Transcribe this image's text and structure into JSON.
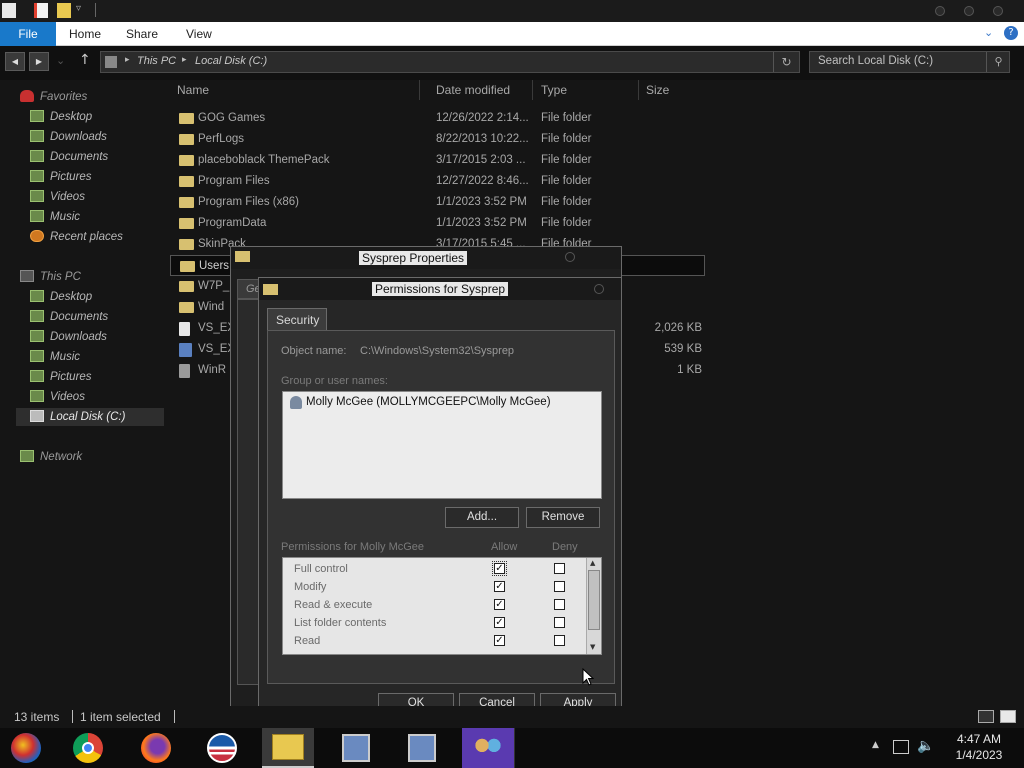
{
  "ribbon": {
    "file": "File",
    "home": "Home",
    "share": "Share",
    "view": "View"
  },
  "address": {
    "crumb1": "This PC",
    "crumb2": "Local Disk (C:)",
    "search_placeholder": "Search Local Disk (C:)"
  },
  "nav": {
    "favorites": "Favorites",
    "fav_items": [
      "Desktop",
      "Downloads",
      "Documents",
      "Pictures",
      "Videos",
      "Music",
      "Recent places"
    ],
    "this_pc": "This PC",
    "pc_items": [
      "Desktop",
      "Documents",
      "Downloads",
      "Music",
      "Pictures",
      "Videos",
      "Local Disk (C:)"
    ],
    "network": "Network"
  },
  "columns": {
    "name": "Name",
    "date": "Date modified",
    "type": "Type",
    "size": "Size"
  },
  "files": [
    {
      "name": "GOG Games",
      "date": "12/26/2022 2:14...",
      "type": "File folder",
      "size": ""
    },
    {
      "name": "PerfLogs",
      "date": "8/22/2013 10:22...",
      "type": "File folder",
      "size": ""
    },
    {
      "name": "placeboblack ThemePack",
      "date": "3/17/2015 2:03 ...",
      "type": "File folder",
      "size": ""
    },
    {
      "name": "Program Files",
      "date": "12/27/2022 8:46...",
      "type": "File folder",
      "size": ""
    },
    {
      "name": "Program Files (x86)",
      "date": "1/1/2023 3:52 PM",
      "type": "File folder",
      "size": ""
    },
    {
      "name": "ProgramData",
      "date": "1/1/2023 3:52 PM",
      "type": "File folder",
      "size": ""
    },
    {
      "name": "SkinPack",
      "date": "3/17/2015 5:45 ...",
      "type": "File folder",
      "size": ""
    },
    {
      "name": "Users",
      "date": "",
      "type": "",
      "size": ""
    },
    {
      "name": "W7P_",
      "date": "",
      "type": "",
      "size": ""
    },
    {
      "name": "Wind",
      "date": "",
      "type": "",
      "size": ""
    },
    {
      "name": "VS_EX",
      "date": "",
      "type": "",
      "size": "2,026 KB"
    },
    {
      "name": "VS_EX",
      "date": "",
      "type": "",
      "size": "539 KB"
    },
    {
      "name": "WinR",
      "date": "",
      "type": "",
      "size": "1 KB"
    }
  ],
  "status": {
    "count": "13 items",
    "selected": "1 item selected"
  },
  "props_dialog": {
    "title": "Sysprep Properties",
    "tab_stub": "Ge"
  },
  "perm_dialog": {
    "title": "Permissions for Sysprep",
    "tab": "Security",
    "object_label": "Object name:",
    "object_value": "C:\\Windows\\System32\\Sysprep",
    "group_label": "Group or user names:",
    "users": [
      "Molly McGee (MOLLYMCGEEPC\\Molly McGee)"
    ],
    "add": "Add...",
    "remove": "Remove",
    "perms_label": "Permissions for Molly McGee",
    "allow": "Allow",
    "deny": "Deny",
    "permissions": [
      {
        "name": "Full control",
        "allow": true,
        "deny": false
      },
      {
        "name": "Modify",
        "allow": true,
        "deny": false
      },
      {
        "name": "Read & execute",
        "allow": true,
        "deny": false
      },
      {
        "name": "List folder contents",
        "allow": true,
        "deny": false
      },
      {
        "name": "Read",
        "allow": true,
        "deny": false
      }
    ],
    "ok": "OK",
    "cancel": "Cancel",
    "apply": "Apply"
  },
  "clock": {
    "time": "4:47 AM",
    "date": "1/4/2023"
  }
}
